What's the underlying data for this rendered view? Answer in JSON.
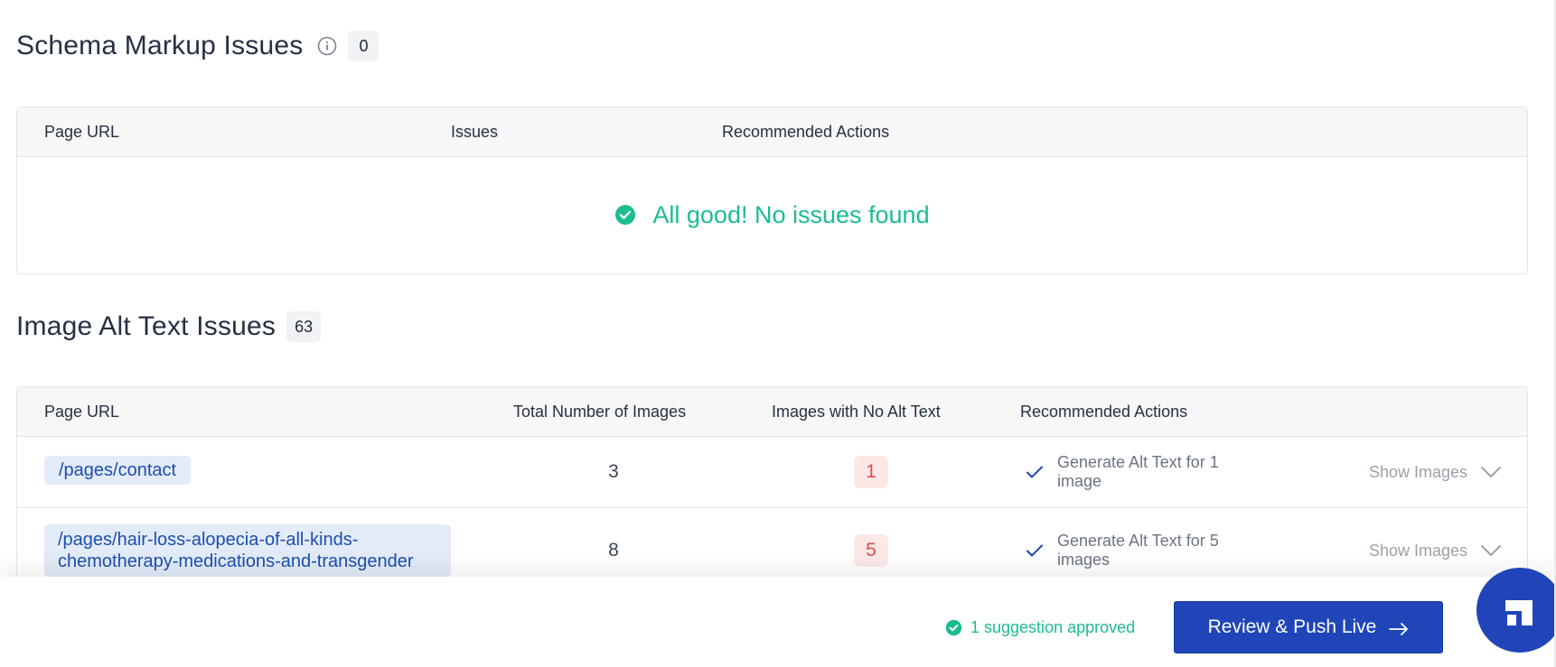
{
  "schema_section": {
    "title": "Schema Markup Issues",
    "count": "0",
    "columns": [
      "Page URL",
      "Issues",
      "Recommended Actions"
    ],
    "empty_message": "All good! No issues found"
  },
  "alt_section": {
    "title": "Image Alt Text Issues",
    "count": "63",
    "columns": [
      "Page URL",
      "Total Number of Images",
      "Images with No Alt Text",
      "Recommended Actions"
    ],
    "rows": [
      {
        "url": "/pages/contact",
        "total_images": "3",
        "no_alt": "1",
        "action": "Generate Alt Text for 1 image",
        "toggle": "Show Images"
      },
      {
        "url": "/pages/hair-loss-alopecia-of-all-kinds-chemotherapy-medications-and-transgender",
        "total_images": "8",
        "no_alt": "5",
        "action": "Generate Alt Text for 5 images",
        "toggle": "Show Images"
      }
    ]
  },
  "footer": {
    "approved_text": "1 suggestion approved",
    "push_button": "Review & Push Live"
  },
  "colors": {
    "accent": "#1f45b8",
    "success": "#1cbd8c",
    "danger": "#e24e4e",
    "link": "#1c4fae"
  },
  "icons": [
    "info-icon",
    "check-circle-icon",
    "check-icon",
    "chevron-down-icon",
    "arrow-right-icon",
    "app-logo-icon"
  ]
}
